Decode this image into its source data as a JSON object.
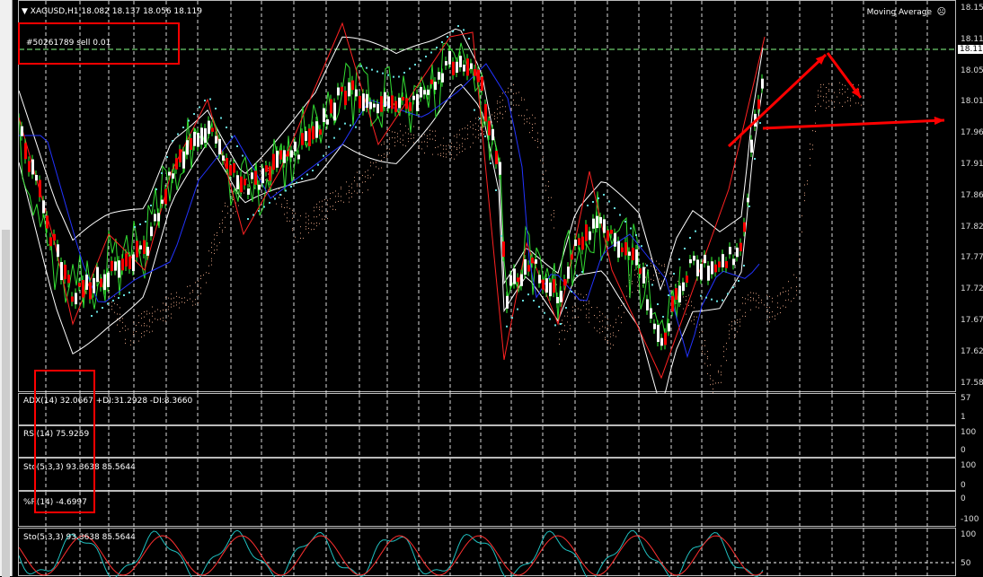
{
  "chart_header": {
    "title": "XAGUSD,H1  18.082 18.137 18.056 18.119",
    "indicator_name": "Moving Average"
  },
  "order_label": "#50261789 sell 0.01",
  "current_price": "18.119",
  "price_axis": [
    "18.15",
    "18.11",
    "18.05",
    "18.01",
    "17.96",
    "17.91",
    "17.86",
    "17.82",
    "17.77",
    "17.72",
    "17.67",
    "17.62",
    "17.58"
  ],
  "indicators": [
    {
      "label": "ADX(14) 32.0667 +DI:31.2928 -DI:8.3660",
      "axis": [
        "57",
        "1"
      ]
    },
    {
      "label": "RSI(14) 75.9259",
      "axis": [
        "100",
        "0"
      ]
    },
    {
      "label": "Sto(5,3,3) 93.3638 85.5644",
      "axis": [
        "100",
        "0"
      ]
    },
    {
      "label": "%R(14) -4.6997",
      "axis": [
        "0",
        "-100"
      ]
    },
    {
      "label": "Sto(5,3,3) 93.3638 85.5644",
      "axis": [
        "100",
        "50"
      ]
    }
  ],
  "colors": {
    "bull_candle": "#ffffff",
    "bear_candle": "#ff0000",
    "wick": "#00ff00",
    "annotation": "#ff0000",
    "grid": "#ffffff"
  }
}
